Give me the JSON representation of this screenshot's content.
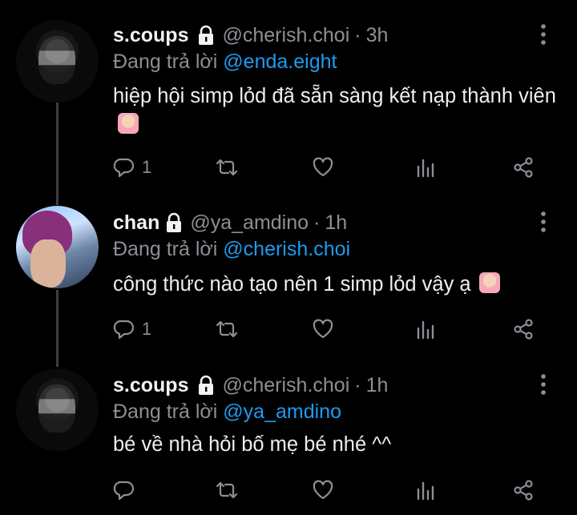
{
  "tweets": [
    {
      "name": "s.coups",
      "handle": "@cherish.choi",
      "dot": "·",
      "time": "3h",
      "replying_prefix": "Đang trả lời",
      "replying_to": "@enda.eight",
      "text": "hiệp hội simp lỏd đã sẵn sàng kết nạp thành viên",
      "emoji": "person-raising-hand-emoji",
      "reply_count": "1"
    },
    {
      "name": "chan",
      "handle": "@ya_amdino",
      "dot": "·",
      "time": "1h",
      "replying_prefix": "Đang trả lời",
      "replying_to": "@cherish.choi",
      "text": "công thức nào tạo nên 1 simp lỏd vậy ạ",
      "emoji": "person-shrugging-emoji",
      "reply_count": "1"
    },
    {
      "name": "s.coups",
      "handle": "@cherish.choi",
      "dot": "·",
      "time": "1h",
      "replying_prefix": "Đang trả lời",
      "replying_to": "@ya_amdino",
      "text": "bé về nhà hỏi bố mẹ bé nhé ^^",
      "reply_count": ""
    }
  ],
  "colors": {
    "background": "#000000",
    "text": "#e7e9ea",
    "muted": "#8b9096",
    "mention": "#1d9bf0",
    "thread_line": "#3a3f44"
  }
}
